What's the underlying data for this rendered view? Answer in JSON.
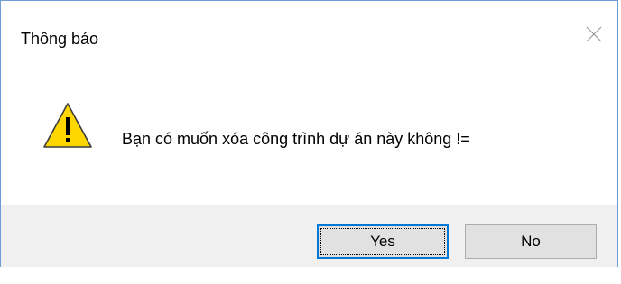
{
  "dialog": {
    "title": "Thông báo",
    "message": "Bạn có muốn xóa công trình dự án này không !=",
    "icon": "warning-icon",
    "close_icon": "close-icon",
    "buttons": {
      "yes_label": "Yes",
      "no_label": "No"
    },
    "default_button": "Yes"
  },
  "colors": {
    "window_border": "#6f9ad6",
    "footer_bg": "#f0f0f0",
    "button_bg": "#e1e1e1",
    "button_border": "#adadad",
    "default_button_border": "#0078d7",
    "warning_fill": "#ffd700",
    "warning_stroke": "#3c3c3c"
  }
}
